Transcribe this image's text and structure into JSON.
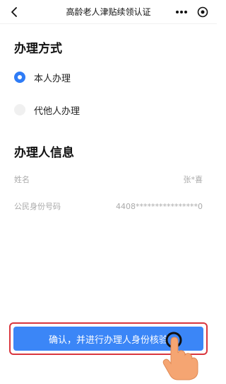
{
  "nav": {
    "back_icon": "chevron-left-icon",
    "title": "高龄老人津贴续领认证",
    "more_icon": "more-dots-icon",
    "target_icon": "target-icon"
  },
  "method": {
    "title": "办理方式",
    "options": [
      {
        "label": "本人办理",
        "checked": true
      },
      {
        "label": "代他人办理",
        "checked": false
      }
    ]
  },
  "info": {
    "title": "办理人信息",
    "rows": [
      {
        "label": "姓名",
        "value": "张*喜"
      },
      {
        "label": "公民身份号码",
        "value": "4408****************0"
      }
    ]
  },
  "confirm": {
    "label": "确认，并进行办理人身份核验"
  },
  "colors": {
    "accent": "#3b86f7",
    "radio_checked": "#2f7cf6",
    "highlight_border": "#d9363e",
    "hand": "#f5a572"
  }
}
